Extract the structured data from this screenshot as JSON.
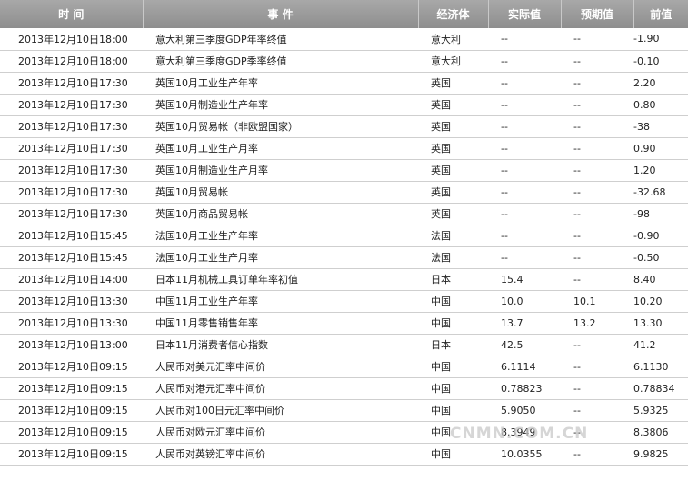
{
  "header": {
    "time": "时 间",
    "event": "事 件",
    "economy": "经济体",
    "actual": "实际值",
    "forecast": "预期值",
    "previous": "前值"
  },
  "rows": [
    {
      "time": "2013年12月10日18:00",
      "event": "意大利第三季度GDP年率终值",
      "economy": "意大利",
      "actual": "--",
      "forecast": "--",
      "previous": "-1.90"
    },
    {
      "time": "2013年12月10日18:00",
      "event": "意大利第三季度GDP季率终值",
      "economy": "意大利",
      "actual": "--",
      "forecast": "--",
      "previous": "-0.10"
    },
    {
      "time": "2013年12月10日17:30",
      "event": "英国10月工业生产年率",
      "economy": "英国",
      "actual": "--",
      "forecast": "--",
      "previous": "2.20"
    },
    {
      "time": "2013年12月10日17:30",
      "event": "英国10月制造业生产年率",
      "economy": "英国",
      "actual": "--",
      "forecast": "--",
      "previous": "0.80"
    },
    {
      "time": "2013年12月10日17:30",
      "event": "英国10月贸易帐（非欧盟国家）",
      "economy": "英国",
      "actual": "--",
      "forecast": "--",
      "previous": "-38"
    },
    {
      "time": "2013年12月10日17:30",
      "event": "英国10月工业生产月率",
      "economy": "英国",
      "actual": "--",
      "forecast": "--",
      "previous": "0.90"
    },
    {
      "time": "2013年12月10日17:30",
      "event": "英国10月制造业生产月率",
      "economy": "英国",
      "actual": "--",
      "forecast": "--",
      "previous": "1.20"
    },
    {
      "time": "2013年12月10日17:30",
      "event": "英国10月贸易帐",
      "economy": "英国",
      "actual": "--",
      "forecast": "--",
      "previous": "-32.68"
    },
    {
      "time": "2013年12月10日17:30",
      "event": "英国10月商品贸易帐",
      "economy": "英国",
      "actual": "--",
      "forecast": "--",
      "previous": "-98"
    },
    {
      "time": "2013年12月10日15:45",
      "event": "法国10月工业生产年率",
      "economy": "法国",
      "actual": "--",
      "forecast": "--",
      "previous": "-0.90"
    },
    {
      "time": "2013年12月10日15:45",
      "event": "法国10月工业生产月率",
      "economy": "法国",
      "actual": "--",
      "forecast": "--",
      "previous": "-0.50"
    },
    {
      "time": "2013年12月10日14:00",
      "event": "日本11月机械工具订单年率初值",
      "economy": "日本",
      "actual": "15.4",
      "forecast": "--",
      "previous": "8.40"
    },
    {
      "time": "2013年12月10日13:30",
      "event": "中国11月工业生产年率",
      "economy": "中国",
      "actual": "10.0",
      "forecast": "10.1",
      "previous": "10.20"
    },
    {
      "time": "2013年12月10日13:30",
      "event": "中国11月零售销售年率",
      "economy": "中国",
      "actual": "13.7",
      "forecast": "13.2",
      "previous": "13.30"
    },
    {
      "time": "2013年12月10日13:00",
      "event": "日本11月消费者信心指数",
      "economy": "日本",
      "actual": "42.5",
      "forecast": "--",
      "previous": "41.2"
    },
    {
      "time": "2013年12月10日09:15",
      "event": "人民币对美元汇率中间价",
      "economy": "中国",
      "actual": "6.1114",
      "forecast": "--",
      "previous": "6.1130"
    },
    {
      "time": "2013年12月10日09:15",
      "event": "人民币对港元汇率中间价",
      "economy": "中国",
      "actual": "0.78823",
      "forecast": "--",
      "previous": "0.78834"
    },
    {
      "time": "2013年12月10日09:15",
      "event": "人民币对100日元汇率中间价",
      "economy": "中国",
      "actual": "5.9050",
      "forecast": "--",
      "previous": "5.9325"
    },
    {
      "time": "2013年12月10日09:15",
      "event": "人民币对欧元汇率中间价",
      "economy": "中国",
      "actual": "8.3949",
      "forecast": "--",
      "previous": "8.3806"
    },
    {
      "time": "2013年12月10日09:15",
      "event": "人民币对英镑汇率中间价",
      "economy": "中国",
      "actual": "10.0355",
      "forecast": "--",
      "previous": "9.9825"
    }
  ],
  "watermark": "CNMN.COM.CN"
}
